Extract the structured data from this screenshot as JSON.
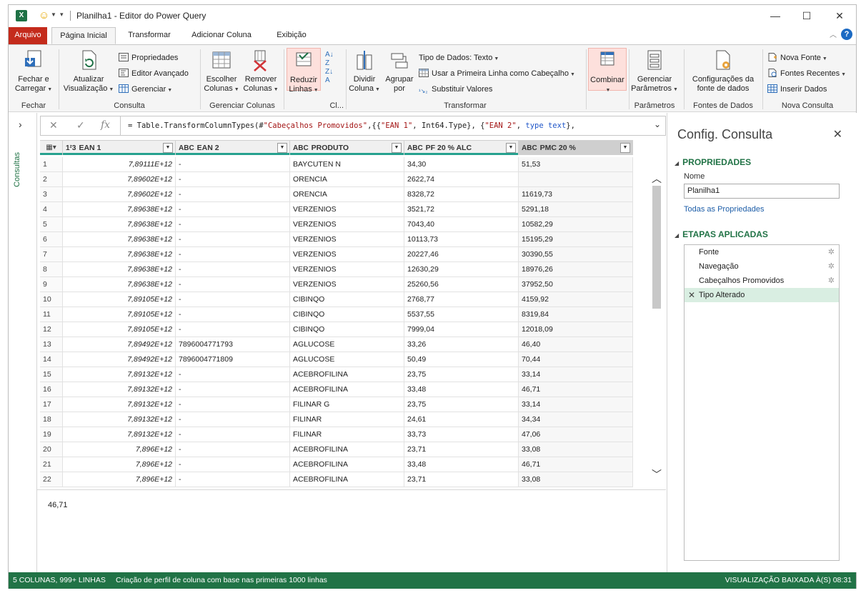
{
  "window": {
    "title": "Planilha1 - Editor do Power Query",
    "logo": "X"
  },
  "tabs": [
    "Arquivo",
    "Página Inicial",
    "Transformar",
    "Adicionar Coluna",
    "Exibição"
  ],
  "ribbon": {
    "fechar": {
      "btn1": "Fechar e",
      "btn2": "Carregar",
      "group": "Fechar"
    },
    "consulta": {
      "atualizar1": "Atualizar",
      "atualizar2": "Visualização",
      "propriedades": "Propriedades",
      "editor": "Editor Avançado",
      "gerenciar": "Gerenciar",
      "group": "Consulta"
    },
    "colunas": {
      "escolher1": "Escolher",
      "escolher2": "Colunas",
      "remover1": "Remover",
      "remover2": "Colunas",
      "group": "Gerenciar Colunas"
    },
    "reduzir": {
      "btn1": "Reduzir",
      "btn2": "Linhas",
      "group": "Cl..."
    },
    "transformar": {
      "dividir1": "Dividir",
      "dividir2": "Coluna",
      "agrupar1": "Agrupar",
      "agrupar2": "por",
      "tipo": "Tipo de Dados: Texto",
      "primeira": "Usar a Primeira Linha como Cabeçalho",
      "substituir": "Substituir Valores",
      "group": "Transformar"
    },
    "combinar": {
      "btn": "Combinar"
    },
    "parametros": {
      "btn1": "Gerenciar",
      "btn2": "Parâmetros",
      "group": "Parâmetros"
    },
    "fontes": {
      "btn1": "Configurações da",
      "btn2": "fonte de dados",
      "group": "Fontes de Dados"
    },
    "nova": {
      "nova_fonte": "Nova Fonte",
      "recentes": "Fontes Recentes",
      "inserir": "Inserir Dados",
      "group": "Nova Consulta"
    }
  },
  "leftnav": {
    "label": "Consultas"
  },
  "formula": {
    "part1": "= Table.TransformColumnTypes(#",
    "part2": "\"Cabeçalhos Promovidos\"",
    "part3": ",{{",
    "part4": "\"EAN 1\"",
    "part5": ", Int64.Type}, {",
    "part6": "\"EAN 2\"",
    "part7": ", ",
    "part8": "type text",
    "part9": "},"
  },
  "columns": [
    {
      "type": "1²3",
      "name": "EAN 1"
    },
    {
      "type": "ABC",
      "name": "EAN 2"
    },
    {
      "type": "ABC",
      "name": "PRODUTO"
    },
    {
      "type": "ABC",
      "name": "PF 20 % ALC"
    },
    {
      "type": "ABC",
      "name": "PMC 20 %"
    }
  ],
  "rows": [
    [
      "1",
      "7,89111E+12",
      "-",
      "BAYCUTEN N",
      "34,30",
      "51,53"
    ],
    [
      "2",
      "7,89602E+12",
      "-",
      "ORENCIA",
      "2622,74",
      ""
    ],
    [
      "3",
      "7,89602E+12",
      "-",
      "ORENCIA",
      "8328,72",
      "11619,73"
    ],
    [
      "4",
      "7,89638E+12",
      "-",
      "VERZENIOS",
      "3521,72",
      "5291,18"
    ],
    [
      "5",
      "7,89638E+12",
      "-",
      "VERZENIOS",
      "7043,40",
      "10582,29"
    ],
    [
      "6",
      "7,89638E+12",
      "-",
      "VERZENIOS",
      "10113,73",
      "15195,29"
    ],
    [
      "7",
      "7,89638E+12",
      "-",
      "VERZENIOS",
      "20227,46",
      "30390,55"
    ],
    [
      "8",
      "7,89638E+12",
      "-",
      "VERZENIOS",
      "12630,29",
      "18976,26"
    ],
    [
      "9",
      "7,89638E+12",
      "-",
      "VERZENIOS",
      "25260,56",
      "37952,50"
    ],
    [
      "10",
      "7,89105E+12",
      "-",
      "CIBINQO",
      "2768,77",
      "4159,92"
    ],
    [
      "11",
      "7,89105E+12",
      "-",
      "CIBINQO",
      "5537,55",
      "8319,84"
    ],
    [
      "12",
      "7,89105E+12",
      "-",
      "CIBINQO",
      "7999,04",
      "12018,09"
    ],
    [
      "13",
      "7,89492E+12",
      "7896004771793",
      "AGLUCOSE",
      "33,26",
      "46,40"
    ],
    [
      "14",
      "7,89492E+12",
      "7896004771809",
      "AGLUCOSE",
      "50,49",
      "70,44"
    ],
    [
      "15",
      "7,89132E+12",
      "-",
      "ACEBROFILINA",
      "23,75",
      "33,14"
    ],
    [
      "16",
      "7,89132E+12",
      "-",
      "ACEBROFILINA",
      "33,48",
      "46,71"
    ],
    [
      "17",
      "7,89132E+12",
      "-",
      "FILINAR G",
      "23,75",
      "33,14"
    ],
    [
      "18",
      "7,89132E+12",
      "-",
      "FILINAR",
      "24,61",
      "34,34"
    ],
    [
      "19",
      "7,89132E+12",
      "-",
      "FILINAR",
      "33,73",
      "47,06"
    ],
    [
      "20",
      "7,896E+12",
      "-",
      "ACEBROFILINA",
      "23,71",
      "33,08"
    ],
    [
      "21",
      "7,896E+12",
      "-",
      "ACEBROFILINA",
      "33,48",
      "46,71"
    ],
    [
      "22",
      "7,896E+12",
      "-",
      "ACEBROFILINA",
      "23,71",
      "33,08"
    ]
  ],
  "preview_value": "46,71",
  "query_settings": {
    "title": "Config. Consulta",
    "props_header": "PROPRIEDADES",
    "name_label": "Nome",
    "name_value": "Planilha1",
    "all_props": "Todas as Propriedades",
    "steps_header": "ETAPAS APLICADAS",
    "steps": [
      "Fonte",
      "Navegação",
      "Cabeçalhos Promovidos",
      "Tipo Alterado"
    ]
  },
  "status": {
    "left": "5 COLUNAS, 999+ LINHAS",
    "middle": "Criação de perfil de coluna com base nas primeiras 1000 linhas",
    "right": "VISUALIZAÇÃO BAIXADA À(S) 08:31"
  },
  "colors": {
    "accent": "#217346",
    "file_tab": "#c42b1c",
    "step_active": "#d9eee2"
  }
}
